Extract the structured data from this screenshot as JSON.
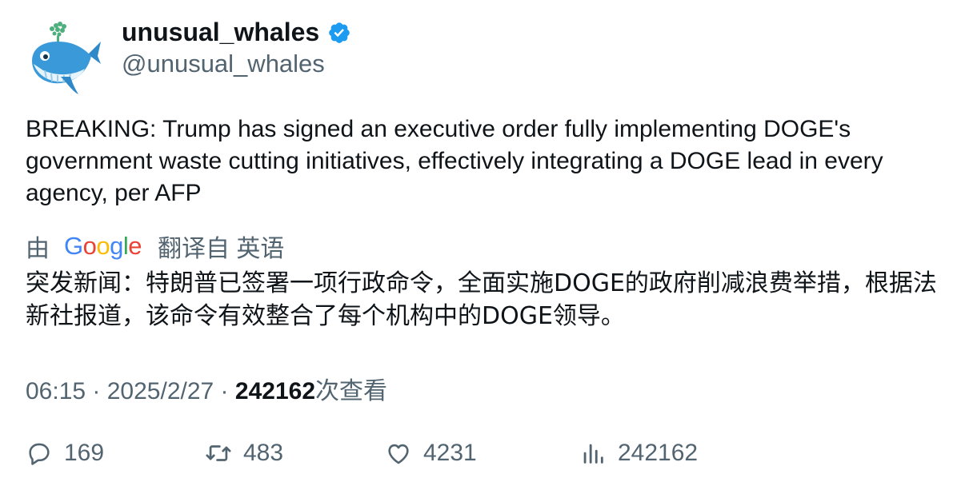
{
  "author": {
    "display_name": "unusual_whales",
    "handle": "@unusual_whales",
    "verified_icon": "verified-badge-icon",
    "avatar_icon": "whale-avatar-icon",
    "verified_color": "#1d9bf0"
  },
  "tweet": {
    "text": "BREAKING: Trump has signed an executive order fully implementing DOGE's government waste cutting initiatives, effectively integrating a DOGE lead in every agency, per AFP"
  },
  "translation": {
    "prefix": "由",
    "provider": "Google",
    "suffix": "翻译自 英语",
    "text": "突发新闻：特朗普已签署一项行政命令，全面实施DOGE的政府削减浪费举措，根据法新社报道，该命令有效整合了每个机构中的DOGE领导。"
  },
  "meta": {
    "time": "06:15",
    "separator1": " · ",
    "date": "2025/2/27",
    "separator2": " · ",
    "views_count": "242162",
    "views_label": "次查看"
  },
  "actions": {
    "replies": "169",
    "retweets": "483",
    "likes": "4231",
    "views": "242162"
  },
  "colors": {
    "text": "#0f1419",
    "secondary": "#536471",
    "google_blue": "#4285f4",
    "google_red": "#ea4335",
    "google_yellow": "#fbbc05",
    "google_green": "#34a853"
  }
}
